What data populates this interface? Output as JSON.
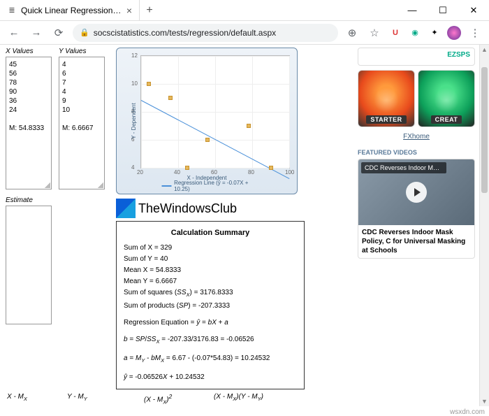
{
  "browser": {
    "tab_title": "Quick Linear Regression Calculat",
    "url": "socscistatistics.com/tests/regression/default.aspx"
  },
  "inputs": {
    "x_label": "X Values",
    "y_label": "Y Values",
    "estimate_label": "Estimate",
    "x_text": "45\n56\n78\n90\n36\n24\n\nM: 54.8333",
    "y_text": "4\n6\n7\n4\n9\n10\n\nM: 6.6667"
  },
  "chart_data": {
    "type": "scatter",
    "title": "",
    "xlabel": "X - Independent",
    "ylabel": "Y - Dependent",
    "xlim": [
      20,
      100
    ],
    "ylim": [
      4,
      12
    ],
    "x_ticks": [
      20,
      40,
      60,
      80,
      100
    ],
    "y_ticks": [
      4,
      6,
      8,
      10,
      12
    ],
    "points": [
      {
        "x": 45,
        "y": 4
      },
      {
        "x": 56,
        "y": 6
      },
      {
        "x": 78,
        "y": 7
      },
      {
        "x": 90,
        "y": 4
      },
      {
        "x": 36,
        "y": 9
      },
      {
        "x": 24,
        "y": 10
      }
    ],
    "regression": {
      "slope": -0.07,
      "intercept": 10.25,
      "label": "Regression Line (ŷ = -0.07X + 10.25)"
    }
  },
  "summary": {
    "heading": "Calculation Summary",
    "lines": {
      "sum_x": "Sum of X = 329",
      "sum_y": "Sum of Y = 40",
      "mean_x": "Mean X = 54.8333",
      "mean_y": "Mean Y = 6.6667",
      "ssx": "Sum of squares (SSX) = 3176.8333",
      "sp": "Sum of products (SP) = -207.3333",
      "eq": "Regression Equation = ŷ = bX + a",
      "b": "b = SP/SSX = -207.33/3176.83 = -0.06526",
      "a": "a = MY - bMX = 6.67 - (-0.07*54.83) = 10.24532",
      "yhat": "ŷ = -0.06526X + 10.24532"
    }
  },
  "footer": {
    "c1": "X - MX",
    "c2": "Y - MY",
    "c3": "(X - MX)²",
    "c4": "(X - MX)(Y - MY)"
  },
  "overlay": {
    "text": "TheWindowsClub"
  },
  "sidebar": {
    "ad1": "EZSPS",
    "mascots": [
      "STARTER",
      "CREAT"
    ],
    "ad_link": "FXhome",
    "featured": "FEATURED VIDEOS",
    "video_overlay": "CDC Reverses Indoor Mask P...",
    "video_title": "CDC Reverses Indoor Mask Policy, C for Universal Masking at Schools"
  },
  "watermark": "wsxdn.com"
}
